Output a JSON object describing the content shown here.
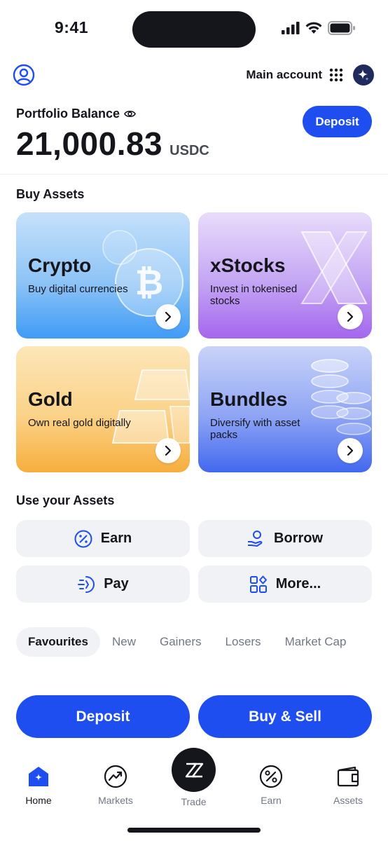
{
  "status_bar": {
    "time": "9:41"
  },
  "header": {
    "account_label": "Main account"
  },
  "balance": {
    "label": "Portfolio Balance",
    "value": "21,000.83",
    "currency": "USDC",
    "deposit_label": "Deposit"
  },
  "buy_assets": {
    "title": "Buy Assets",
    "cards": [
      {
        "name": "Crypto",
        "desc": "Buy digital currencies",
        "icon": "bitcoin-coin-icon"
      },
      {
        "name": "xStocks",
        "desc": "Invest in tokenised stocks",
        "icon": "x-logo-icon"
      },
      {
        "name": "Gold",
        "desc": "Own real gold digitally",
        "icon": "gold-bars-icon"
      },
      {
        "name": "Bundles",
        "desc": "Diversify with asset packs",
        "icon": "coin-stack-icon"
      }
    ]
  },
  "use_assets": {
    "title": "Use your Assets",
    "buttons": [
      {
        "label": "Earn",
        "icon": "percent-circle-icon"
      },
      {
        "label": "Borrow",
        "icon": "hand-coin-icon"
      },
      {
        "label": "Pay",
        "icon": "pay-icon"
      },
      {
        "label": "More...",
        "icon": "apps-icon"
      }
    ]
  },
  "tabs": [
    "Favourites",
    "New",
    "Gainers",
    "Losers",
    "Market Cap"
  ],
  "active_tab": "Favourites",
  "actions": {
    "deposit_label": "Deposit",
    "buy_sell_label": "Buy & Sell"
  },
  "bottom_nav": [
    {
      "label": "Home",
      "icon": "home-icon",
      "active": true
    },
    {
      "label": "Markets",
      "icon": "markets-icon",
      "active": false
    },
    {
      "label": "Trade",
      "icon": "trade-icon",
      "active": false
    },
    {
      "label": "Earn",
      "icon": "percent-icon",
      "active": false
    },
    {
      "label": "Assets",
      "icon": "wallet-icon",
      "active": false
    }
  ],
  "colors": {
    "accent": "#1e4ef0",
    "text": "#14161c",
    "muted": "#727784",
    "button_bg": "#f1f2f5"
  }
}
